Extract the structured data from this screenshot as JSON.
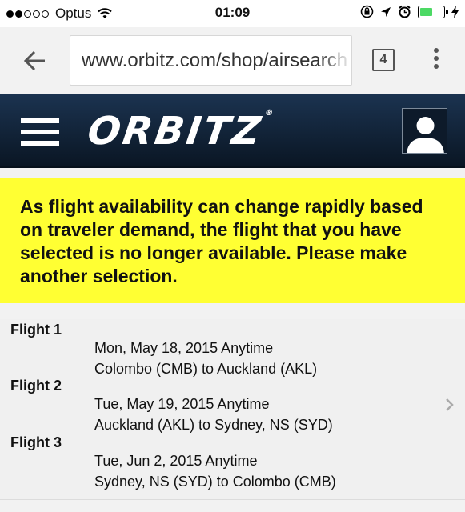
{
  "status_bar": {
    "carrier": "Optus",
    "time": "01:09",
    "signal_bars_filled": 2,
    "signal_bars_total": 5,
    "battery_level": 0.55,
    "battery_color": "#4cd964"
  },
  "browser": {
    "url": "www.orbitz.com/shop/airsearch",
    "tab_count": "4"
  },
  "header": {
    "logo_text": "ORBITZ",
    "logo_mark": "®",
    "background": "#0f2136"
  },
  "alert": {
    "message": "As flight availability can change rapidly based on traveler demand, the flight that you have selected is no longer available. Please make another selection.",
    "background": "#ffff33"
  },
  "flights": [
    {
      "label": "Flight 1",
      "date": "Mon, May 18, 2015 Anytime",
      "route": "Colombo (CMB) to Auckland (AKL)"
    },
    {
      "label": "Flight 2",
      "date": "Tue, May 19, 2015 Anytime",
      "route": "Auckland (AKL) to Sydney, NS (SYD)"
    },
    {
      "label": "Flight 3",
      "date": "Tue, Jun 2, 2015 Anytime",
      "route": "Sydney, NS (SYD) to Colombo (CMB)"
    }
  ]
}
